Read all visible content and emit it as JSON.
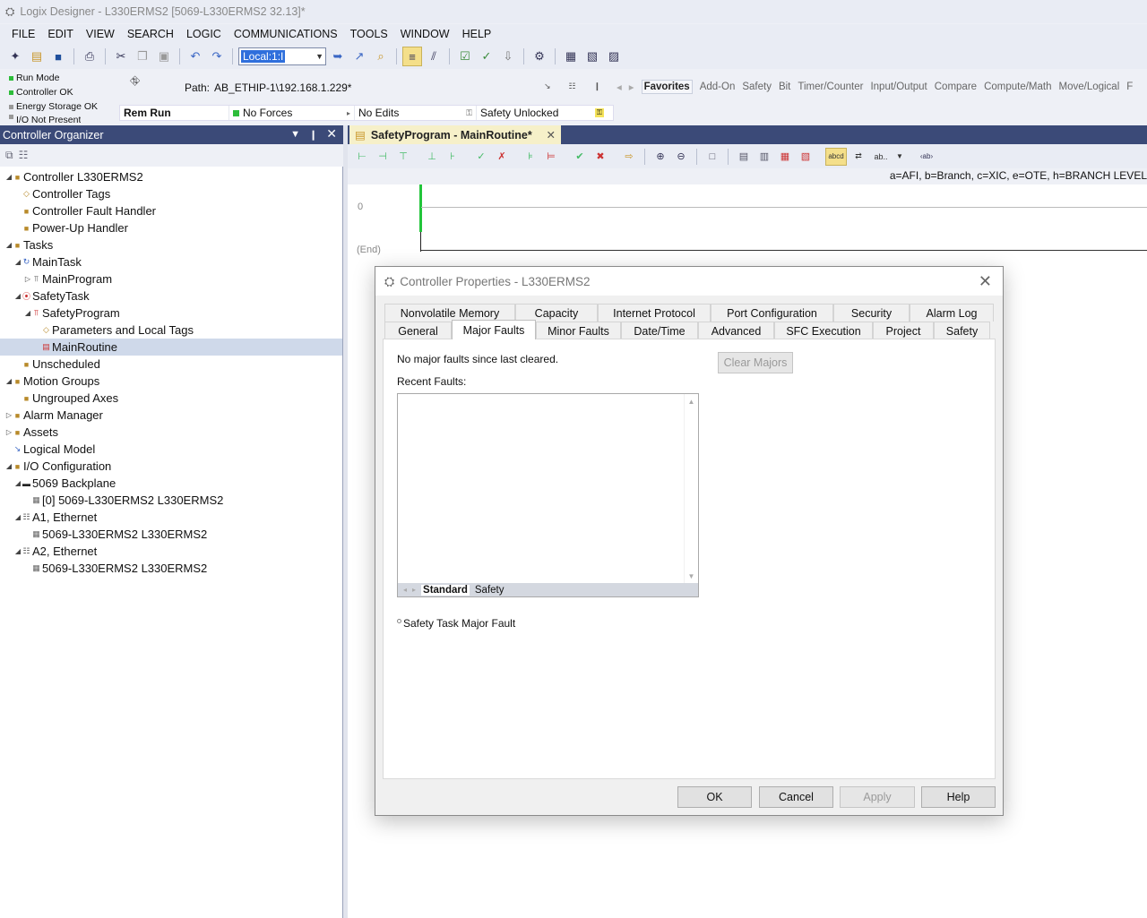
{
  "window": {
    "title": "Logix Designer - L330ERMS2 [5069-L330ERMS2 32.13]*"
  },
  "menu": [
    "FILE",
    "EDIT",
    "VIEW",
    "SEARCH",
    "LOGIC",
    "COMMUNICATIONS",
    "TOOLS",
    "WINDOW",
    "HELP"
  ],
  "toolbar": {
    "path_combo": "Local:1:I"
  },
  "status": {
    "items": [
      "Run Mode",
      "Controller OK",
      "Energy Storage OK",
      "I/O Not Present"
    ],
    "path_label": "Path:",
    "path_value": "AB_ETHIP-1\\192.168.1.229*",
    "mode": "Rem Run",
    "forces": "No Forces",
    "edits": "No Edits",
    "safety": "Safety Unlocked"
  },
  "instruction_tabs": [
    "Favorites",
    "Add-On",
    "Safety",
    "Bit",
    "Timer/Counter",
    "Input/Output",
    "Compare",
    "Compute/Math",
    "Move/Logical",
    "F"
  ],
  "organizer": {
    "title": "Controller Organizer",
    "tree": [
      {
        "label": "Controller L330ERMS2"
      },
      {
        "label": "Controller Tags"
      },
      {
        "label": "Controller Fault Handler"
      },
      {
        "label": "Power-Up Handler"
      },
      {
        "label": "Tasks"
      },
      {
        "label": "MainTask"
      },
      {
        "label": "MainProgram"
      },
      {
        "label": "SafetyTask"
      },
      {
        "label": "SafetyProgram"
      },
      {
        "label": "Parameters and Local Tags"
      },
      {
        "label": "MainRoutine"
      },
      {
        "label": "Unscheduled"
      },
      {
        "label": "Motion Groups"
      },
      {
        "label": "Ungrouped Axes"
      },
      {
        "label": "Alarm Manager"
      },
      {
        "label": "Assets"
      },
      {
        "label": "Logical Model"
      },
      {
        "label": "I/O Configuration"
      },
      {
        "label": "5069 Backplane"
      },
      {
        "label": "[0] 5069-L330ERMS2 L330ERMS2"
      },
      {
        "label": "A1, Ethernet"
      },
      {
        "label": "5069-L330ERMS2 L330ERMS2"
      },
      {
        "label": "A2, Ethernet"
      },
      {
        "label": "5069-L330ERMS2 L330ERMS2"
      }
    ]
  },
  "editor": {
    "tab_title": "SafetyProgram - MainRoutine*",
    "legend": "a=AFI, b=Branch, c=XIC, e=OTE, h=BRANCH LEVEL",
    "rung_number": "0",
    "end_label": "(End)"
  },
  "dialog": {
    "title": "Controller Properties - L330ERMS2",
    "tabs_row1": [
      "Nonvolatile Memory",
      "Capacity",
      "Internet Protocol",
      "Port Configuration",
      "Security",
      "Alarm Log"
    ],
    "tabs_row2": [
      "General",
      "Major Faults",
      "Minor Faults",
      "Date/Time",
      "Advanced",
      "SFC Execution",
      "Project",
      "Safety"
    ],
    "active_tab": "Major Faults",
    "message": "No major faults since last cleared.",
    "clear_button": "Clear Majors",
    "recent_label": "Recent Faults:",
    "sub_tabs": [
      "Standard",
      "Safety"
    ],
    "checkbox_label": "Safety Task Major Fault",
    "buttons": {
      "ok": "OK",
      "cancel": "Cancel",
      "apply": "Apply",
      "help": "Help"
    }
  }
}
